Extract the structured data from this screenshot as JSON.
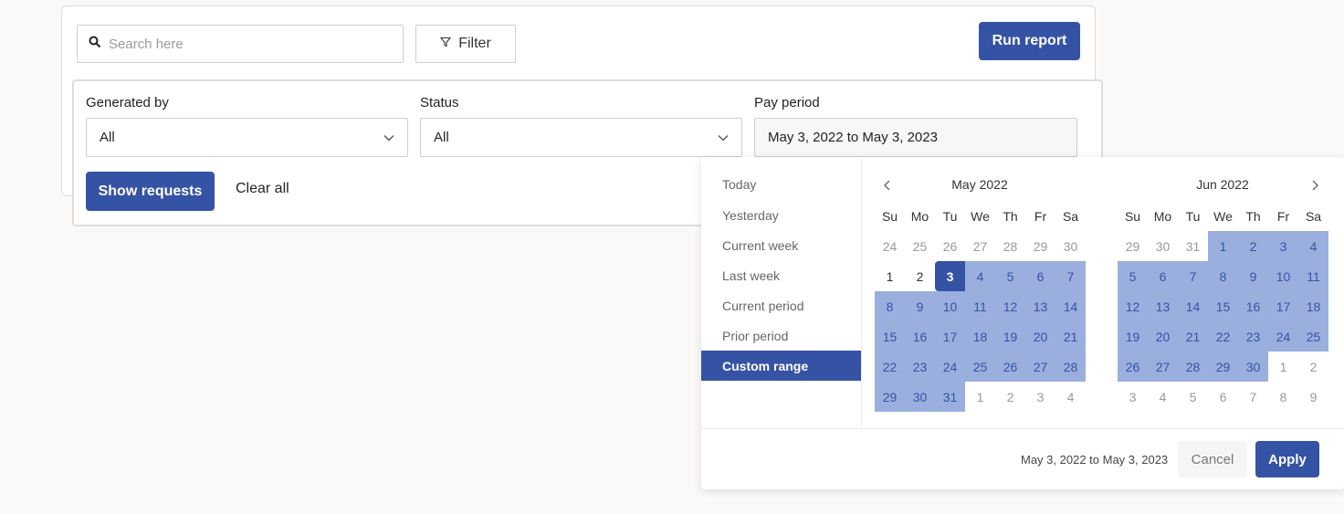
{
  "toolbar": {
    "search_placeholder": "Search here",
    "filter_label": "Filter",
    "run_report_label": "Run report"
  },
  "filters": {
    "generated_by": {
      "label": "Generated by",
      "value": "All"
    },
    "status": {
      "label": "Status",
      "value": "All"
    },
    "pay_period": {
      "label": "Pay period",
      "value": "May 3, 2022 to May 3, 2023"
    },
    "show_requests_label": "Show requests",
    "clear_all_label": "Clear all"
  },
  "picker": {
    "presets": [
      "Today",
      "Yesterday",
      "Current week",
      "Last week",
      "Current period",
      "Prior period",
      "Custom range"
    ],
    "active_preset": "Custom range",
    "weekdays": [
      "Su",
      "Mo",
      "Tu",
      "We",
      "Th",
      "Fr",
      "Sa"
    ],
    "months": [
      {
        "title": "May 2022",
        "weeks": [
          [
            "24",
            "25",
            "26",
            "27",
            "28",
            "29",
            "30"
          ],
          [
            "1",
            "2",
            "3",
            "4",
            "5",
            "6",
            "7"
          ],
          [
            "8",
            "9",
            "10",
            "11",
            "12",
            "13",
            "14"
          ],
          [
            "15",
            "16",
            "17",
            "18",
            "19",
            "20",
            "21"
          ],
          [
            "22",
            "23",
            "24",
            "25",
            "26",
            "27",
            "28"
          ],
          [
            "29",
            "30",
            "31",
            "1",
            "2",
            "3",
            "4"
          ]
        ]
      },
      {
        "title": "Jun 2022",
        "weeks": [
          [
            "29",
            "30",
            "31",
            "1",
            "2",
            "3",
            "4"
          ],
          [
            "5",
            "6",
            "7",
            "8",
            "9",
            "10",
            "11"
          ],
          [
            "12",
            "13",
            "14",
            "15",
            "16",
            "17",
            "18"
          ],
          [
            "19",
            "20",
            "21",
            "22",
            "23",
            "24",
            "25"
          ],
          [
            "26",
            "27",
            "28",
            "29",
            "30",
            "1",
            "2"
          ],
          [
            "3",
            "4",
            "5",
            "6",
            "7",
            "8",
            "9"
          ]
        ]
      }
    ],
    "selected_start": "May 3, 2022",
    "range_text": "May 3, 2022 to May 3, 2023",
    "cancel_label": "Cancel",
    "apply_label": "Apply"
  },
  "colors": {
    "accent": "#3553a4",
    "range": "#9aafde"
  }
}
